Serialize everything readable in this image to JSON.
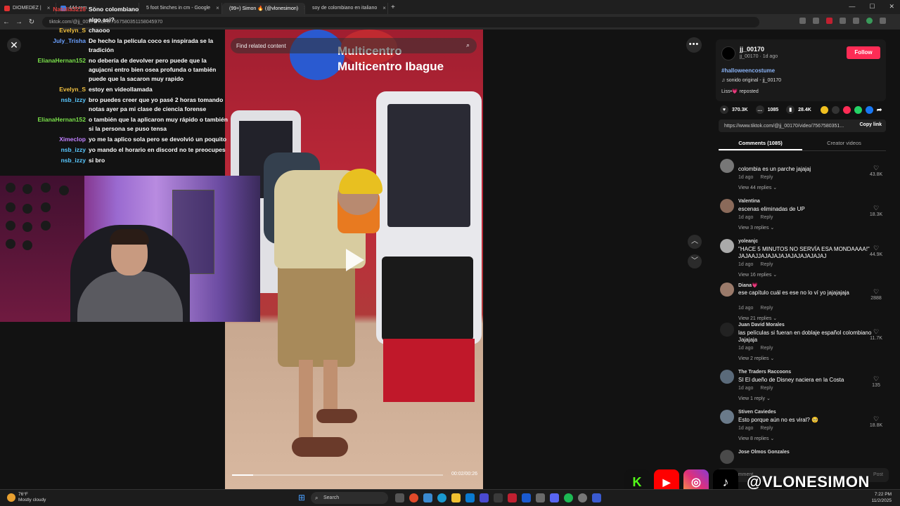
{
  "browser": {
    "tabs": [
      {
        "label": "DIOMEDEZ |",
        "color": "#e03030"
      },
      {
        "label": "444 rem",
        "color": "#3a7ae0"
      },
      {
        "label": "5 foot 5inches in cm - Google",
        "color": "#4a90e2"
      },
      {
        "label": "(99+) Simon 🔥 (@vlonesimon)",
        "color": "#111"
      },
      {
        "label": "soy de colombiano en italiano",
        "color": "#4a90e2"
      }
    ],
    "url": "tiktok.com/@jj_00170/video/7567580351158045970",
    "window_controls": [
      "—",
      "☐",
      "✕"
    ]
  },
  "chat": {
    "messages": [
      {
        "user": "Natalia3218",
        "color": "#e04040",
        "text": "Sono colombiano"
      },
      {
        "user": "",
        "color": "#ffffff",
        "text": "algo asi?"
      },
      {
        "user": "Evelyn_S",
        "color": "#f0c040",
        "text": "chaooo"
      },
      {
        "user": "July_Trisha",
        "color": "#6aa0ff",
        "text": "De hecho la película coco es inspirada se la tradición"
      },
      {
        "user": "ElianaHernan152",
        "color": "#7ae04a",
        "text": "no debería de devolver pero puede que la agujacni entro bien osea profunda o también puede que la sacaron muy rapido"
      },
      {
        "user": "Evelyn_S",
        "color": "#f0c040",
        "text": "estoy en videollamada"
      },
      {
        "user": "nsb_izzy",
        "color": "#5ac8ff",
        "text": "bro puedes creer que yo pasé 2 horas tomando notas ayer pa mi clase de ciencia forense"
      },
      {
        "user": "ElianaHernan152",
        "color": "#7ae04a",
        "text": "o también que la aplicaron muy rápido o también si la persona se puso tensa"
      },
      {
        "user": "Ximeclop",
        "color": "#c080ff",
        "text": "yo me la aplico sola pero se devolvió un poquito"
      },
      {
        "user": "nsb_izzy",
        "color": "#5ac8ff",
        "text": "yo mando el horario en discord no te preocupes"
      },
      {
        "user": "nsb_izzy",
        "color": "#5ac8ff",
        "text": "si bro"
      }
    ]
  },
  "video": {
    "search_placeholder": "Find related content",
    "wall_text_1": "Multicentro",
    "wall_text_2": "Multicentro Ibague",
    "timecode": "00:02/00:26",
    "progress_fraction": 0.1
  },
  "panel": {
    "author_name": "jj_00170",
    "author_meta": "jj_00170 · 1d ago",
    "follow_label": "Follow",
    "hashtag": "#halloweencostume",
    "sound": "♫  sonido original - jj_00170",
    "repost": "Liss•💗 reposted",
    "likes": "370.3K",
    "comments_count": "1085",
    "saves": "28.4K",
    "link": "https://www.tiktok.com/@jj_00170/video/7567580351...",
    "copy_link": "Copy link",
    "tab_comments": "Comments (1085)",
    "tab_creator": "Creator videos",
    "comment_placeholder": "Add comment...",
    "post_label": "Post"
  },
  "comments": [
    {
      "name": "",
      "text": "colombia es un parche jajajaj",
      "time": "1d ago",
      "reply": "Reply",
      "replies": "View 44 replies",
      "likes": "43.8K",
      "avatar": "#777"
    },
    {
      "name": "Valentina",
      "text": "escenas eliminadas de UP",
      "time": "1d ago",
      "reply": "Reply",
      "replies": "View 3 replies",
      "likes": "18.3K",
      "avatar": "#8a6a5a"
    },
    {
      "name": "yoleanjc",
      "text": "\"HACE 5 MINUTOS NO SERVÍA ESA MONDAAAA!\" JAJAAJJAJAJAJAJAJAJAJAJAJAJ",
      "time": "1d ago",
      "reply": "Reply",
      "replies": "View 16 replies",
      "likes": "44.9K",
      "avatar": "#aaa"
    },
    {
      "name": "Diana💗",
      "text": "ese capítulo cuál es ese no lo ví yo jajajajaja",
      "time": "1d ago",
      "reply": "Reply",
      "replies": "View 21 replies",
      "likes": "2888",
      "avatar": "#9a7a6a"
    },
    {
      "name": "Juan David Morales",
      "text": "las películas si fueran en doblaje español colombiano Jajajaja",
      "time": "1d ago",
      "reply": "Reply",
      "replies": "View 2 replies",
      "likes": "11.7K",
      "avatar": "#222"
    },
    {
      "name": "The Traders Raccoons",
      "text": "SI El dueño de Disney naciera en la Costa",
      "time": "1d ago",
      "reply": "Reply",
      "replies": "View 1 reply",
      "likes": "135",
      "avatar": "#5a6a7a"
    },
    {
      "name": "Stiven Caviedes",
      "text": "Esto porque aún no es viral? 🥺",
      "time": "1d ago",
      "reply": "Reply",
      "replies": "View 8 replies",
      "likes": "18.8K",
      "avatar": "#6a7a8a"
    },
    {
      "name": "Jose Olmos Gonzales",
      "text": "",
      "time": "",
      "reply": "",
      "replies": "",
      "likes": "",
      "avatar": "#4a4a4a"
    }
  ],
  "overlay": {
    "handle": "@VLONESIMON"
  },
  "taskbar": {
    "temp": "76°F",
    "weather": "Mostly cloudy",
    "search": "Search",
    "time": "7:22 PM",
    "date": "11/2/2025"
  }
}
